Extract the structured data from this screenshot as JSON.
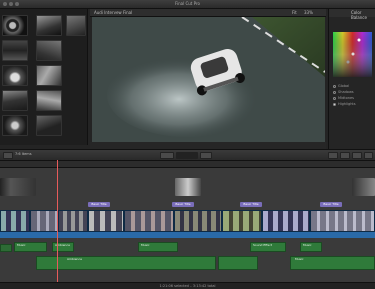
{
  "app": {
    "title": "Final Cut Pro"
  },
  "viewer": {
    "project_name": "Audi Intervew Final",
    "quality_label": "Fit",
    "zoom_label": "33%"
  },
  "inspector": {
    "tab_label": "Color Balance",
    "color_radios": [
      {
        "label": "Global",
        "selected": false
      },
      {
        "label": "Shadows",
        "selected": false
      },
      {
        "label": "Midtones",
        "selected": false
      },
      {
        "label": "Highlights",
        "selected": true
      }
    ]
  },
  "timeline": {
    "index_label": "7:6 Items",
    "title_clips": [
      "Basic Title",
      "Basic Title",
      "Basic Title",
      "Basic Title"
    ],
    "audio_clips": [
      "Music",
      "Ambience",
      "Music",
      "Sound Effect",
      "Music",
      "Ambience",
      "Music"
    ]
  },
  "status": {
    "text": "1:21:06 selected – 3:13:42 total"
  },
  "colors": {
    "accent": "#3b8fdb",
    "audio": "#2f7a3a",
    "title_clip": "#7a6dba",
    "playhead": "#e65b5b"
  }
}
